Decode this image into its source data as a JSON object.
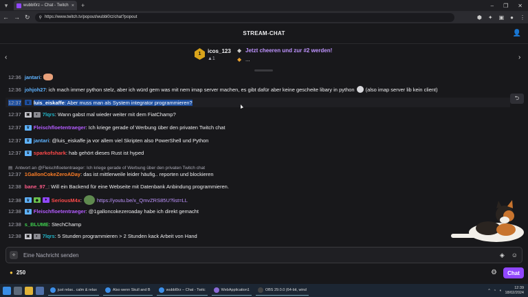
{
  "browser": {
    "tab_title": "wubbl0rz – Chat - Twitch",
    "tab_close": "×",
    "new_tab": "+",
    "url": "https://www.twitch.tv/popout/wubbl0rz/chat?popout",
    "win_min": "–",
    "win_max": "❐",
    "win_close": "✕"
  },
  "chat": {
    "title": "STREAM-CHAT"
  },
  "hype": {
    "rank_badge": "1",
    "user": "icos_123",
    "count": "▲1",
    "cheer_text": "Jetzt cheeren und zur #2 werden!",
    "dots": "..."
  },
  "messages": [
    {
      "time": "12:36",
      "user": "jantari",
      "color": "#5fb3ff",
      "text": ": "
    },
    {
      "time": "12:36",
      "user": "johjoh27",
      "color": "#5fb3ff",
      "text": ": ich mach immer python stelz, aber ich würd gern was mit nem imap server machen, es gibt dafür aber keine gescheite libary in python",
      "text2": "(also imap server lib kein client)"
    },
    {
      "time": "12:37",
      "user": "luis_eiskaffe",
      "color": "#ffffff",
      "text": ": Aber muss man als System integrator programmieren?"
    },
    {
      "time": "12:37",
      "user": "7lqrs",
      "color": "#22b5c8",
      "text": ": Wann gabst mal wieder weiter mit dem FiatChamp?"
    },
    {
      "time": "12:37",
      "user": "Fleischfloetentraeger",
      "color": "#b45cff",
      "text": ": Ich kriege gerade of Werbung über den privaten Twitch chat"
    },
    {
      "time": "12:37",
      "user": "jantari",
      "color": "#5fb3ff",
      "text": ": @luis_eiskaffe ja vor allem viel Skripten also PowerShell und Python"
    },
    {
      "time": "12:37",
      "user": "sparkofshark",
      "color": "#ff4a4a",
      "text": ": hab gehört dieses Rust ist hyped"
    },
    {
      "time": "12:37",
      "user": "1GallonCokeZeroADay",
      "color": "#ff7f27",
      "text": ": das ist mittlerweile leider häufig.. reporten und blockieren"
    },
    {
      "time": "12:38",
      "user": "bane_97_",
      "color": "#ff5c8a",
      "text": ": Will ein Backend für eine Webseite mit Datenbank Anbindung programmieren."
    },
    {
      "time": "12:38",
      "user": "SeriousM4x",
      "color": "#ff4a4a",
      "text": ": ",
      "link": "https://youtu.be/x_QmvZRS85U?list=LL"
    },
    {
      "time": "12:38",
      "user": "Fleischfloetentraeger",
      "color": "#b45cff",
      "text": ": @1galloncokezeroaday habe ich direkt gemacht"
    },
    {
      "time": "12:38",
      "user": "s_BLUME",
      "color": "#3fcf4f",
      "text": ": StechChamp"
    },
    {
      "time": "12:38",
      "user": "7lqrs",
      "color": "#22b5c8",
      "text": ": 5 Stunden programmieren > 2 Stunden kack Arbeit von Hand"
    }
  ],
  "reply_note": "Antwort an @Fleischfloetentraeger: Ich kriege gerade of Werbung über den privaten Twitch chat",
  "input": {
    "placeholder": "Eine Nachricht senden",
    "points": "250",
    "send_label": "Chat"
  },
  "taskbar": {
    "app1": "just relax.. calm & relax",
    "app2": "Also wenn Skull and B",
    "app3": "wubbl0rz – Chat - Twitc",
    "app4": "WebApplication1",
    "app5": "OBS 29.0.0 (64-bit, wind",
    "time": "12:39",
    "date": "18/02/2024"
  },
  "colors": {
    "accent": "#9147ff",
    "bg": "#18181b"
  }
}
